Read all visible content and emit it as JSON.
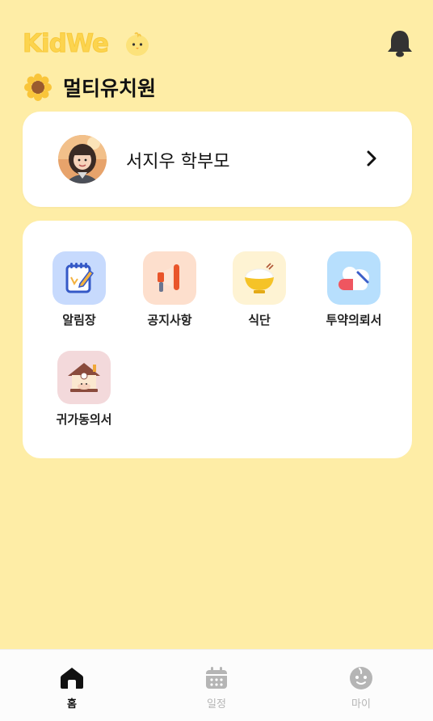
{
  "header": {
    "logo_text": "KidWe",
    "logo_color": "#FCD44E"
  },
  "kindergarten": {
    "name": "멀티유치원"
  },
  "profile": {
    "name": "서지우 학부모"
  },
  "menu": {
    "items": [
      {
        "label": "알림장",
        "icon": "notebook-icon",
        "bg": "#C7DAFD"
      },
      {
        "label": "공지사항",
        "icon": "megaphone-icon",
        "bg": "#FDDFCD"
      },
      {
        "label": "식단",
        "icon": "rice-bowl-icon",
        "bg": "#FEF3D3"
      },
      {
        "label": "투약의뢰서",
        "icon": "pill-icon",
        "bg": "#B7DFFD"
      },
      {
        "label": "귀가동의서",
        "icon": "house-icon",
        "bg": "#F3D9DB"
      }
    ]
  },
  "nav": {
    "items": [
      {
        "label": "홈",
        "icon": "home-icon",
        "active": true
      },
      {
        "label": "일정",
        "icon": "calendar-icon",
        "active": false
      },
      {
        "label": "마이",
        "icon": "face-icon",
        "active": false
      }
    ]
  },
  "colors": {
    "background": "#FEEDA6",
    "card": "#FFFFFF",
    "nav_active": "#111111",
    "nav_inactive": "#B5B5B5"
  }
}
